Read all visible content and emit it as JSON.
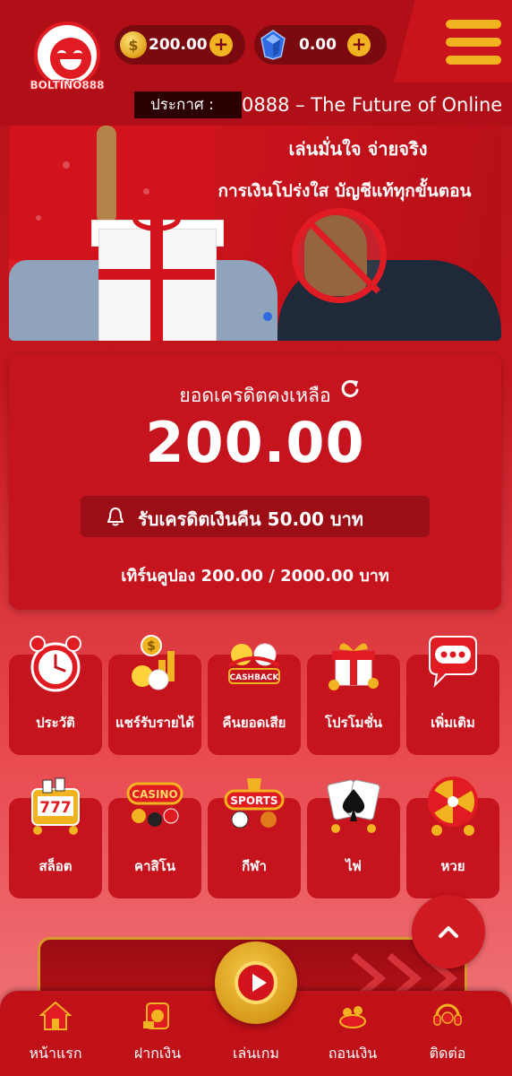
{
  "header": {
    "logo_text": "BOLTINO888",
    "coin_balance": "200.00",
    "gem_balance": "0.00",
    "plus_label": "+",
    "coin_symbol": "$",
    "announce_label": "ประกาศ :",
    "announce_text": "0888 – The Future of Online"
  },
  "banner": {
    "line1": "เล่นมั่นใจ จ่ายจริง",
    "line2": "การเงินโปร่งใส บัญชีแท้ทุกขั้นตอน"
  },
  "credit": {
    "label": "ยอดเครดิตคงเหลือ",
    "value": "200.00",
    "cashback_text": "รับเครดิตเงินคืน  50.00  บาท",
    "turnover_text": "เทิร์นคูปอง 200.00 / 2000.00 บาท"
  },
  "tiles_row1": [
    {
      "label": "ประวัติ"
    },
    {
      "label": "แชร์รับรายได้"
    },
    {
      "label": "คืนยอดเสีย"
    },
    {
      "label": "โปรโมชั่น"
    },
    {
      "label": "เพิ่มเติม"
    }
  ],
  "tiles_row2": [
    {
      "label": "สล็อต"
    },
    {
      "label": "คาสิโน"
    },
    {
      "label": "กีฬา"
    },
    {
      "label": "ไพ่"
    },
    {
      "label": "หวย"
    }
  ],
  "tile_badges": {
    "cashback": "CASHBACK",
    "casino": "CASINO",
    "sports": "SPORTS",
    "slot": "777"
  },
  "bottom_nav": [
    {
      "label": "หน้าแรก",
      "icon": "home-icon"
    },
    {
      "label": "ฝากเงิน",
      "icon": "deposit-icon"
    },
    {
      "label": "เล่นเกม",
      "icon": "play-icon"
    },
    {
      "label": "ถอนเงิน",
      "icon": "withdraw-icon"
    },
    {
      "label": "ติดต่อ",
      "icon": "contact-icon"
    }
  ],
  "colors": {
    "brand_red": "#c5141d",
    "gold": "#f2b320",
    "dark_red": "#7a0a10"
  }
}
